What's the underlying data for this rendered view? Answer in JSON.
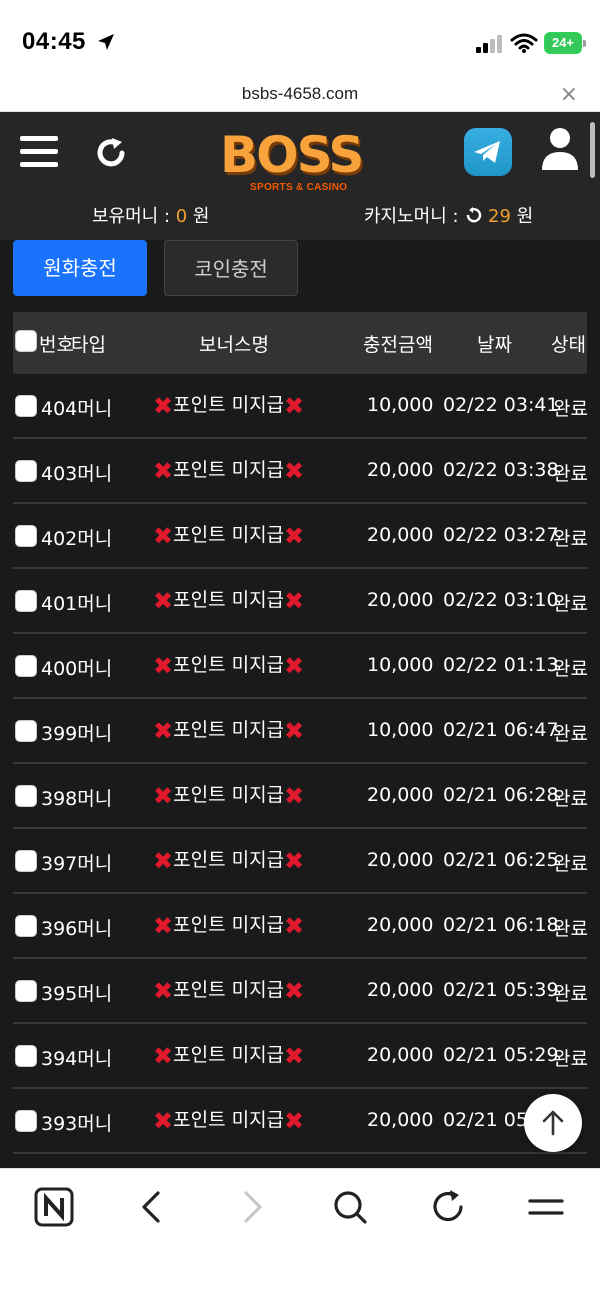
{
  "status_bar": {
    "time": "04:45",
    "battery": "24+"
  },
  "browser": {
    "url": "bsbs-4658.com",
    "close": "×"
  },
  "header": {
    "logo_text": "BOSS",
    "logo_sub": "SPORTS & CASINO",
    "cash_label": "보유머니 : ",
    "cash_value": "0",
    "cash_unit": " 원",
    "casino_label": "카지노머니 : ",
    "casino_value": "29",
    "casino_unit": " 원"
  },
  "tabs": [
    {
      "label": "원화충전",
      "active": true
    },
    {
      "label": "코인충전",
      "active": false
    }
  ],
  "table": {
    "headers": [
      "번호",
      "타입",
      "보너스명",
      "충전금액",
      "날짜",
      "상태"
    ],
    "rows": [
      {
        "num": "404",
        "type": "머니",
        "bonus": "포인트 미지급",
        "amount": "10,000",
        "date": "02/22 03:41",
        "status": "완료"
      },
      {
        "num": "403",
        "type": "머니",
        "bonus": "포인트 미지급",
        "amount": "20,000",
        "date": "02/22 03:38",
        "status": "완료"
      },
      {
        "num": "402",
        "type": "머니",
        "bonus": "포인트 미지급",
        "amount": "20,000",
        "date": "02/22 03:27",
        "status": "완료"
      },
      {
        "num": "401",
        "type": "머니",
        "bonus": "포인트 미지급",
        "amount": "20,000",
        "date": "02/22 03:10",
        "status": "완료"
      },
      {
        "num": "400",
        "type": "머니",
        "bonus": "포인트 미지급",
        "amount": "10,000",
        "date": "02/22 01:13",
        "status": "완료"
      },
      {
        "num": "399",
        "type": "머니",
        "bonus": "포인트 미지급",
        "amount": "10,000",
        "date": "02/21 06:47",
        "status": "완료"
      },
      {
        "num": "398",
        "type": "머니",
        "bonus": "포인트 미지급",
        "amount": "20,000",
        "date": "02/21 06:28",
        "status": "완료"
      },
      {
        "num": "397",
        "type": "머니",
        "bonus": "포인트 미지급",
        "amount": "20,000",
        "date": "02/21 06:25",
        "status": "완료"
      },
      {
        "num": "396",
        "type": "머니",
        "bonus": "포인트 미지급",
        "amount": "20,000",
        "date": "02/21 06:18",
        "status": "완료"
      },
      {
        "num": "395",
        "type": "머니",
        "bonus": "포인트 미지급",
        "amount": "20,000",
        "date": "02/21 05:39",
        "status": "완료"
      },
      {
        "num": "394",
        "type": "머니",
        "bonus": "포인트 미지급",
        "amount": "20,000",
        "date": "02/21 05:29",
        "status": "완료"
      },
      {
        "num": "393",
        "type": "머니",
        "bonus": "포인트 미지급",
        "amount": "20,000",
        "date": "02/21 05:",
        "status": ""
      }
    ]
  },
  "colors": {
    "accent": "#1a73ff",
    "money": "#f0a030",
    "xmark": "#e0192d",
    "logo": "#f7a23a"
  },
  "icons": {
    "menu": "hamburger-icon",
    "refresh": "refresh-icon",
    "telegram": "telegram-icon",
    "user": "user-icon",
    "scroll_top": "arrow-up-icon"
  }
}
